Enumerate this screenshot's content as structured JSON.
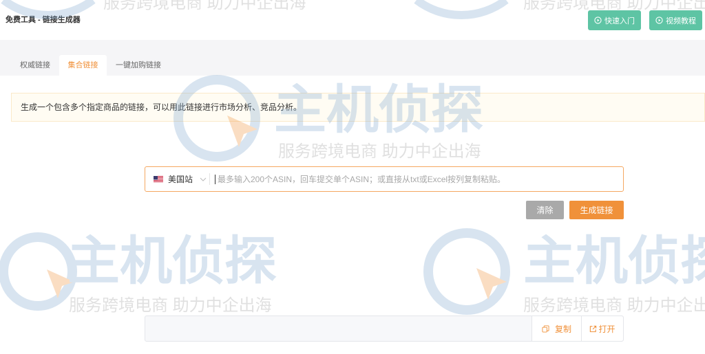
{
  "header": {
    "title": "免费工具 - 链接生成器",
    "quick_start_label": "快速入门",
    "video_tutorial_label": "视频教程"
  },
  "tabs": [
    {
      "label": "权威链接",
      "active": false
    },
    {
      "label": "集合链接",
      "active": true
    },
    {
      "label": "一键加购链接",
      "active": false
    }
  ],
  "notice": {
    "text": "生成一个包含多个指定商品的链接，可以用此链接进行市场分析、竞品分析。"
  },
  "asin_input": {
    "marketplace_label": "美国站",
    "value": "",
    "placeholder": "最多输入200个ASIN，回车提交单个ASIN；或直接从txt或Excel按列复制粘贴。"
  },
  "actions": {
    "clear_label": "清除",
    "generate_label": "生成链接"
  },
  "result": {
    "value": "",
    "copy_label": "复制",
    "open_label": "打开"
  },
  "icons": {
    "quick_start": "play-circle-icon",
    "video_tutorial": "play-circle-icon",
    "marketplace_flag": "us-flag-icon",
    "marketplace_dropdown": "chevron-down-icon",
    "copy": "copy-icon",
    "open": "external-link-icon"
  },
  "colors": {
    "primary_green": "#5ec4a4",
    "accent_orange": "#f0913a",
    "clear_gray": "#a9a9a9",
    "notice_bg": "#fffcf3",
    "tab_bar_bg": "#f5f5f7"
  },
  "watermark": {
    "brand": "主机侦探",
    "slogan": "服务跨境电商 助力中企出海"
  }
}
